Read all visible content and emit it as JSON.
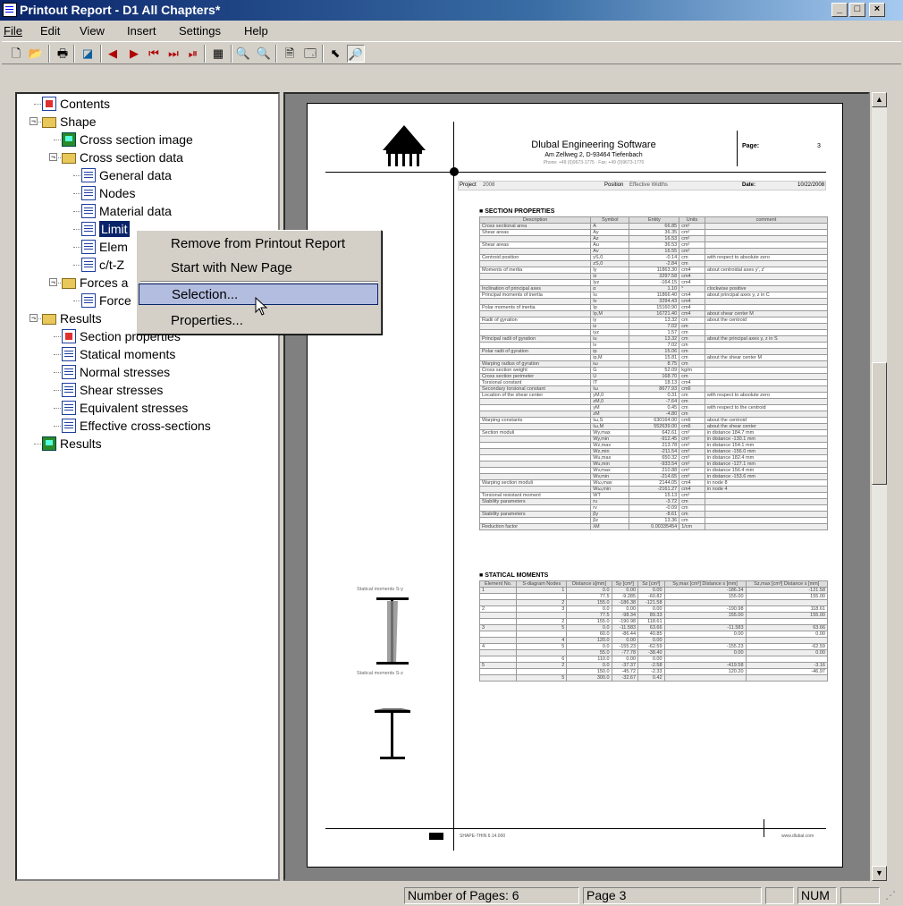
{
  "window": {
    "title": "Printout Report - D1 All Chapters*"
  },
  "menu": [
    "File",
    "Edit",
    "View",
    "Insert",
    "Settings",
    "Help"
  ],
  "tree": [
    {
      "label": "Contents",
      "icon": "red"
    },
    {
      "label": "Shape",
      "icon": "folder"
    },
    {
      "label": "Cross section image",
      "icon": "img"
    },
    {
      "label": "Cross section data",
      "icon": "folder"
    },
    {
      "label": "General data",
      "icon": "doc"
    },
    {
      "label": "Nodes",
      "icon": "doc"
    },
    {
      "label": "Material data",
      "icon": "doc"
    },
    {
      "label": "Limit",
      "icon": "doc"
    },
    {
      "label": "Elem",
      "icon": "doc"
    },
    {
      "label": "c/t-Z",
      "icon": "doc"
    },
    {
      "label": "Forces a",
      "icon": "folder"
    },
    {
      "label": "Force",
      "icon": "doc"
    },
    {
      "label": "Results",
      "icon": "folder"
    },
    {
      "label": "Section properties",
      "icon": "red"
    },
    {
      "label": "Statical moments",
      "icon": "doc"
    },
    {
      "label": "Normal stresses",
      "icon": "doc"
    },
    {
      "label": "Shear stresses",
      "icon": "doc"
    },
    {
      "label": "Equivalent stresses",
      "icon": "doc"
    },
    {
      "label": "Effective cross-sections",
      "icon": "doc"
    },
    {
      "label": "Results",
      "icon": "img"
    }
  ],
  "context_menu": {
    "remove": "Remove from Printout Report",
    "new_page": "Start with New Page",
    "selection": "Selection...",
    "properties": "Properties..."
  },
  "report": {
    "company": "Dlubal Engineering Software",
    "address": "Am Zellweg 2, D-93464 Tiefenbach",
    "phone": "Phone: +49 (0)9673-1775 · Fax: +49 (0)9673-1770",
    "page_label": "Page:",
    "page_value": "3",
    "project_label": "Project",
    "project_value": "2008",
    "position_label": "Position",
    "position_value": "Effective Widths",
    "date_label": "Date:",
    "date_value": "10/22/2008",
    "section1": "SECTION PROPERTIES",
    "section2": "STATICAL MOMENTS",
    "sm_label_y": "Statical moments S-y",
    "sm_label_z": "Statical moments S-z",
    "footer_software": "SHAPE-THIN 6.14.000",
    "footer_url": "www.dlubal.com",
    "sp_headers": [
      "Description",
      "Symbol",
      "Entity",
      "Units",
      "comment"
    ],
    "sp_rows": [
      [
        "Cross sectional area",
        "A",
        "66.85",
        "cm²",
        ""
      ],
      [
        "Shear areas",
        "Ay",
        "36.35",
        "cm²",
        ""
      ],
      [
        "",
        "Az",
        "16.53",
        "cm²",
        ""
      ],
      [
        "Shear areas",
        "Au",
        "36.53",
        "cm²",
        ""
      ],
      [
        "",
        "Av",
        "16.55",
        "cm²",
        ""
      ],
      [
        "Centroid position",
        "yS,0",
        "-0.14",
        "cm",
        "with respect to absolute zero"
      ],
      [
        "",
        "zS,0",
        "-2.84",
        "cm",
        ""
      ],
      [
        "Moments of inertia",
        "Iy",
        "11863.30",
        "cm4",
        "about centroidal axes y', z'"
      ],
      [
        "",
        "Iz",
        "3297.58",
        "cm4",
        ""
      ],
      [
        "",
        "Iyz",
        "-164.15",
        "cm4",
        ""
      ],
      [
        "Inclination of principal axes",
        "α",
        "1.10",
        "°",
        "clockwise positive"
      ],
      [
        "Principal moments of inertia",
        "Iu",
        "11866.40",
        "cm4",
        "about principal axes y, z in C"
      ],
      [
        "",
        "Iv",
        "3294.43",
        "cm4",
        ""
      ],
      [
        "Polar moments of inertia",
        "Ip",
        "15160.90",
        "cm4",
        ""
      ],
      [
        "",
        "Ip,M",
        "16721.40",
        "cm4",
        "about shear center M"
      ],
      [
        "Radii of gyration",
        "iy",
        "13.32",
        "cm",
        "about the centroid"
      ],
      [
        "",
        "iz",
        "7.02",
        "cm",
        ""
      ],
      [
        "",
        "iyz",
        "1.57",
        "cm",
        ""
      ],
      [
        "Principal radii of gyration",
        "iu",
        "13.32",
        "cm",
        "about the principal axes y, z in S"
      ],
      [
        "",
        "iv",
        "7.02",
        "cm",
        ""
      ],
      [
        "Polar radii of gyration",
        "ip",
        "15.06",
        "cm",
        ""
      ],
      [
        "",
        "ip,M",
        "15.81",
        "cm",
        "about the shear center M"
      ],
      [
        "Warping radius of gyration",
        "iω",
        "8.75",
        "cm",
        ""
      ],
      [
        "Cross section weight",
        "G",
        "52.09",
        "kg/m",
        ""
      ],
      [
        "Cross section perimeter",
        "U",
        "168.70",
        "cm",
        ""
      ],
      [
        "Torsional constant",
        "IT",
        "18.13",
        "cm4",
        ""
      ],
      [
        "Secondary torsional constant",
        "Iω",
        "8677.93",
        "cm6",
        ""
      ],
      [
        "Location of the shear center",
        "yM,0",
        "0.31",
        "cm",
        "with respect to absolute zero"
      ],
      [
        "",
        "zM,0",
        "-7.64",
        "cm",
        ""
      ],
      [
        "",
        "yM",
        "0.45",
        "cm",
        "with respect to the centroid"
      ],
      [
        "",
        "zM",
        "-4.80",
        "cm",
        ""
      ],
      [
        "Warping constants",
        "Iω,S",
        "630164.00",
        "cm6",
        "about the centroid"
      ],
      [
        "",
        "Iω,M",
        "552639.00",
        "cm6",
        "about the shear center"
      ],
      [
        "Section moduli",
        "Wy,max",
        "642.61",
        "cm³",
        "in distance 184.7 mm"
      ],
      [
        "",
        "Wy,min",
        "-912.45",
        "cm³",
        "in distance -130.1 mm"
      ],
      [
        "",
        "Wz,max",
        "213.78",
        "cm³",
        "in distance 154.1 mm"
      ],
      [
        "",
        "Wz,min",
        "-211.54",
        "cm³",
        "in distance -156.0 mm"
      ],
      [
        "",
        "Wu,max",
        "650.32",
        "cm³",
        "in distance 182.4 mm"
      ],
      [
        "",
        "Wu,min",
        "-933.54",
        "cm³",
        "in distance -127.1 mm"
      ],
      [
        "",
        "Wv,max",
        "210.88",
        "cm³",
        "in distance 156.4 mm"
      ],
      [
        "",
        "Wv,min",
        "-214.65",
        "cm³",
        "in distance -153.6 mm"
      ],
      [
        "Warping section moduli",
        "Wω,max",
        "2144.05",
        "cm4",
        "in node 8"
      ],
      [
        "",
        "Wω,min",
        "-2161.27",
        "cm4",
        "in node 4"
      ],
      [
        "Torsional resistant moment",
        "WT",
        "15.13",
        "cm³",
        ""
      ],
      [
        "Stability parameters",
        "ru",
        "-3.72",
        "cm",
        ""
      ],
      [
        "",
        "rv",
        "-0.09",
        "cm",
        ""
      ],
      [
        "Stability parameters",
        "βy",
        "-8.61",
        "cm",
        ""
      ],
      [
        "",
        "βz",
        "13.36",
        "cm",
        ""
      ],
      [
        "Reduction factor",
        "λM",
        "0.00335454",
        "1/cm",
        ""
      ]
    ],
    "sm_headers": [
      "Element No.",
      "S-diagram Nodes",
      "Distance s[mm]",
      "Sy [cm³]",
      "Sz [cm³]",
      "Sy,max [cm³] Distance s [mm]",
      "Sz,max [cm³] Distance s [mm]"
    ],
    "sm_rows": [
      [
        "1",
        "1",
        "0.0",
        "0.00",
        "0.00",
        "-186.34",
        "-121.58"
      ],
      [
        "",
        "",
        "77.5",
        "-9.285",
        "-60.82",
        "155.00",
        "155.00"
      ],
      [
        "",
        "2",
        "155.0",
        "-186.38",
        "-121.58",
        "",
        ""
      ],
      [
        "2",
        "3",
        "0.0",
        "0.00",
        "0.00",
        "-190.98",
        "118.61"
      ],
      [
        "",
        "",
        "77.5",
        "-98.34",
        "89.33",
        "155.00",
        "155.00"
      ],
      [
        "",
        "2",
        "155.0",
        "-190.98",
        "118.61",
        "",
        ""
      ],
      [
        "3",
        "5",
        "0.0",
        "-11.583",
        "63.66",
        "-11.583",
        "63.66"
      ],
      [
        "",
        "",
        "60.0",
        "-86.44",
        "40.85",
        "0.00",
        "0.00"
      ],
      [
        "",
        "4",
        "120.0",
        "0.00",
        "0.00",
        "",
        ""
      ],
      [
        "4",
        "5",
        "0.0",
        "-155.23",
        "-62.59",
        "-155.23",
        "-62.59"
      ],
      [
        "",
        "",
        "55.0",
        "-77.78",
        "-38.40",
        "0.00",
        "0.00"
      ],
      [
        "",
        "6",
        "110.0",
        "0.00",
        "0.00",
        "",
        ""
      ],
      [
        "5",
        "2",
        "0.0",
        "-37.37",
        "-2.58",
        "-419.58",
        "-3.16"
      ],
      [
        "",
        "",
        "150.0",
        "-45.72",
        "-2.33",
        "120.20",
        "-46.97"
      ],
      [
        "",
        "5",
        "300.0",
        "-32.67",
        "0.42",
        "",
        ""
      ]
    ]
  },
  "status": {
    "pages": "Number of Pages: 6",
    "page": "Page 3",
    "num": "NUM"
  }
}
